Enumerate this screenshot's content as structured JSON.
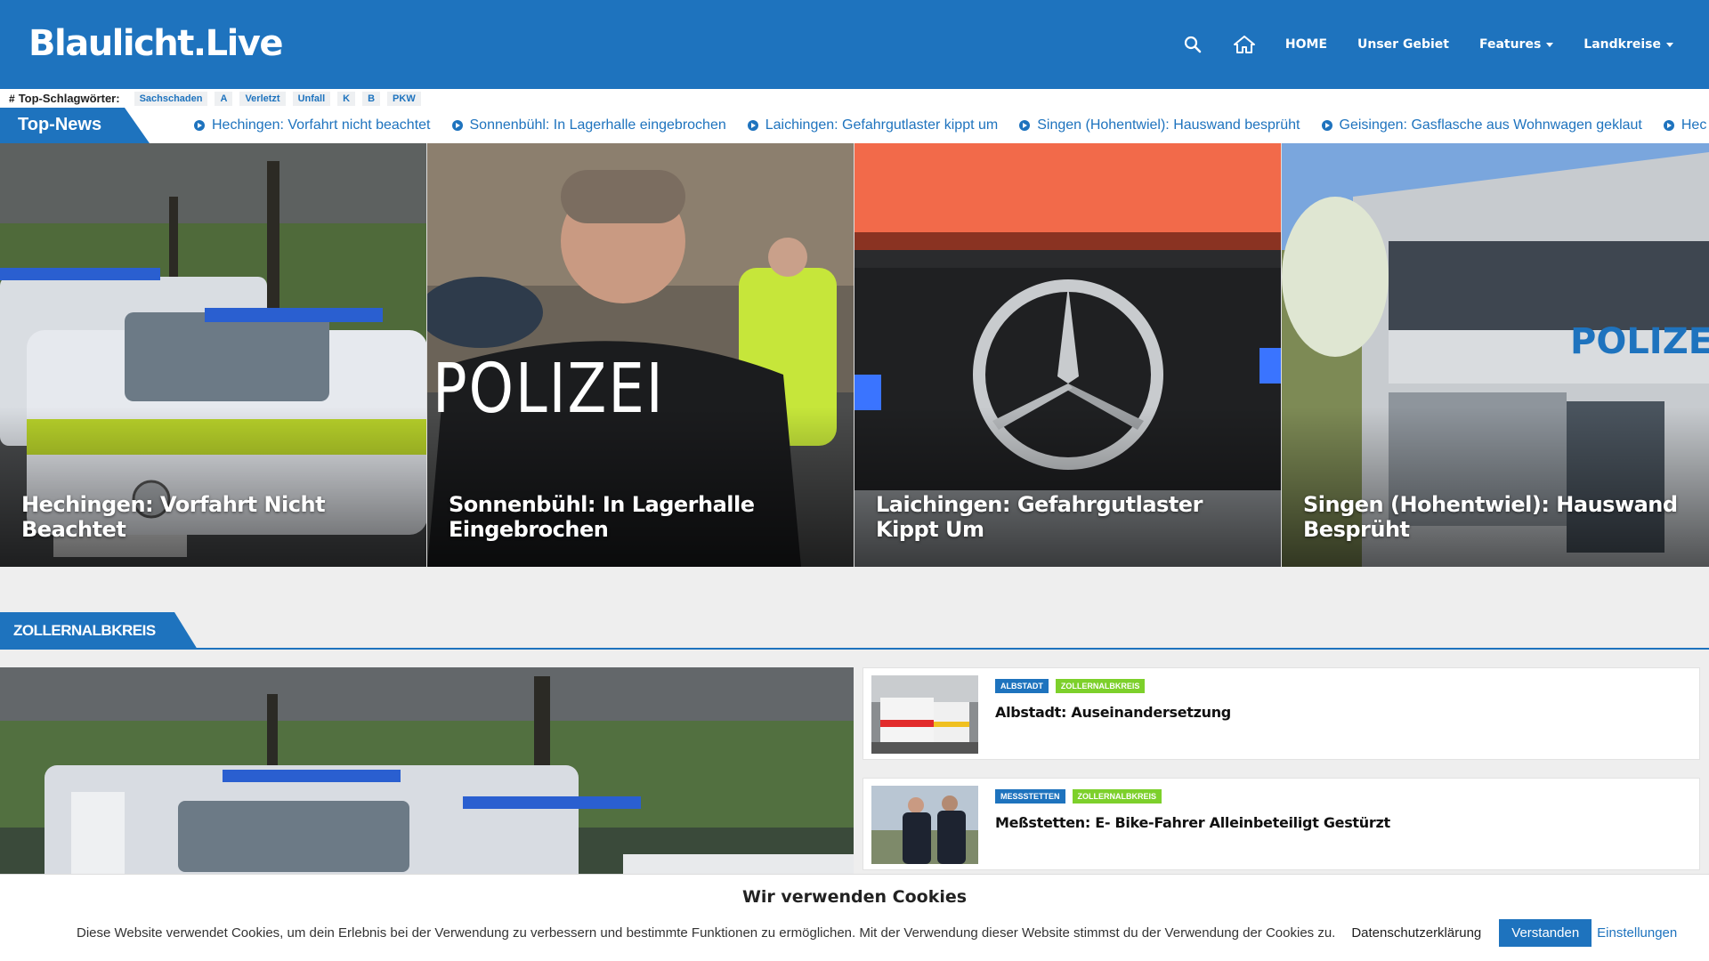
{
  "header": {
    "logo": "Blaulicht.Live",
    "nav": {
      "home": "HOME",
      "area": "Unser Gebiet",
      "features": "Features",
      "districts": "Landkreise"
    },
    "icons": [
      "search-icon",
      "home-icon"
    ]
  },
  "tagbar": {
    "label": "Top-Schlagwörter:",
    "tags": [
      "Sachschaden",
      "A",
      "Verletzt",
      "Unfall",
      "K",
      "B",
      "PKW"
    ]
  },
  "ticker": {
    "label": "Top-News",
    "items": [
      "Hechingen: Vorfahrt nicht beachtet",
      "Sonnenbühl: In Lagerhalle eingebrochen",
      "Laichingen: Gefahrgutlaster kippt um",
      "Singen (Hohentwiel): Hauswand besprüht",
      "Geisingen: Gasflasche aus Wohnwagen geklaut",
      "Hec"
    ]
  },
  "hero": [
    {
      "title": "Hechingen: Vorfahrt Nicht Beachtet"
    },
    {
      "title": "Sonnenbühl: In Lagerhalle Eingebrochen"
    },
    {
      "title": "Laichingen: Gefahrgutlaster Kippt Um"
    },
    {
      "title": "Singen (Hohentwiel): Hauswand Besprüht"
    }
  ],
  "section": {
    "label": "ZOLLERNALBKREIS",
    "list": [
      {
        "badges": [
          "ALBSTADT",
          "ZOLLERNALBKREIS"
        ],
        "title": "Albstadt: Auseinandersetzung"
      },
      {
        "badges": [
          "MESSSTETTEN",
          "ZOLLERNALBKREIS"
        ],
        "title": "Meßstetten: E- Bike-Fahrer Alleinbeteiligt Gestürzt"
      }
    ]
  },
  "image_text": {
    "polizei": "POLIZEI",
    "polize": "POLIZE"
  },
  "cookie": {
    "title": "Wir verwenden Cookies",
    "text": "Diese Website verwendet Cookies, um dein Erlebnis bei der Verwendung zu verbessern und bestimmte Funktionen zu ermöglichen. Mit der Verwendung dieser Website stimmst du der Verwendung der Cookies zu.",
    "privacy": "Datenschutzerklärung",
    "accept": "Verstanden",
    "settings": "Einstellungen"
  },
  "colors": {
    "brand": "#1e73be",
    "badge_green": "#7dd02b"
  }
}
